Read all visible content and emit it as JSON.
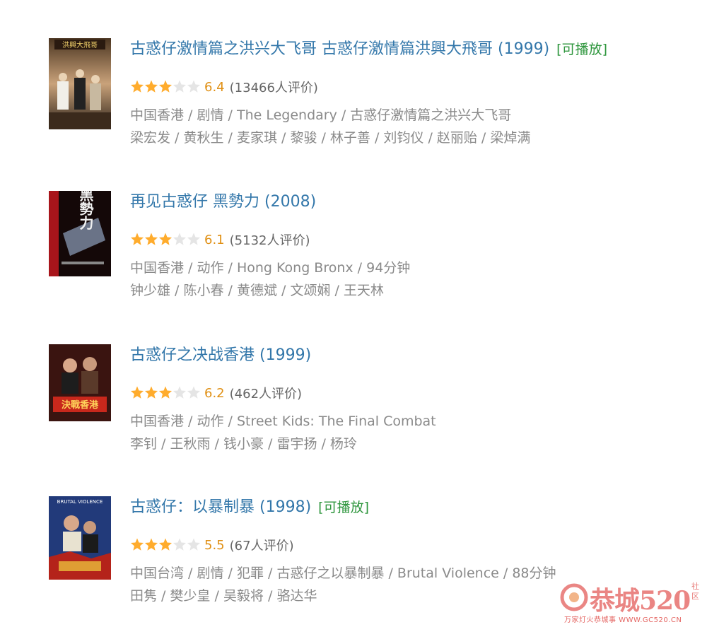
{
  "movies": [
    {
      "title": "古惑仔激情篇之洪兴大飞哥 古惑仔激情篇洪興大飛哥",
      "year": "(1999)",
      "playable": "[可播放]",
      "rating": "6.4",
      "votes": "(13466人评价)",
      "meta": "中国香港 / 剧情 / The Legendary / 古惑仔激情篇之洪兴大飞哥",
      "cast": "梁宏发 / 黄秋生 / 麦家琪 / 黎骏 / 林子善 / 刘钧仪 / 赵丽贻 / 梁焯满"
    },
    {
      "title": "再见古惑仔 黑勢力",
      "year": "(2008)",
      "playable": "",
      "rating": "6.1",
      "votes": "(5132人评价)",
      "meta": "中国香港 / 动作 / Hong Kong Bronx / 94分钟",
      "cast": "钟少雄 / 陈小春 / 黄德斌 / 文颂娴 / 王天林"
    },
    {
      "title": "古惑仔之决战香港",
      "year": "(1999)",
      "playable": "",
      "rating": "6.2",
      "votes": "(462人评价)",
      "meta": "中国香港 / 动作 / Street Kids: The Final Combat",
      "cast": "李钊 / 王秋雨 / 钱小豪 / 雷宇扬 / 杨玲"
    },
    {
      "title": "古惑仔：以暴制暴",
      "year": "(1998)",
      "playable": "[可播放]",
      "rating": "5.5",
      "votes": "(67人评价)",
      "meta": "中国台湾 / 剧情 / 犯罪 / 古惑仔之以暴制暴 / Brutal Violence / 88分钟",
      "cast": "田隽 / 樊少皇 / 吴毅将 / 骆达华"
    }
  ],
  "star_rating": {
    "filled_stars": 3,
    "total_stars": 5
  },
  "posters": [
    {
      "text": "洪興大飛哥"
    },
    {
      "text": "黑勢力"
    },
    {
      "text": "決戰香港"
    },
    {
      "text": "BRUTAL VIOLENCE"
    }
  ],
  "watermark": {
    "brand": "恭城520",
    "side": "社区",
    "url": "万家灯火恭城事 WWW.GC520.CN"
  },
  "colors": {
    "title_link": "#3377aa",
    "playable": "#2e963d",
    "score": "#e09015",
    "star_filled": "#ffac2d",
    "star_empty": "#e5e5e5",
    "meta_text": "#8a8a8a"
  }
}
